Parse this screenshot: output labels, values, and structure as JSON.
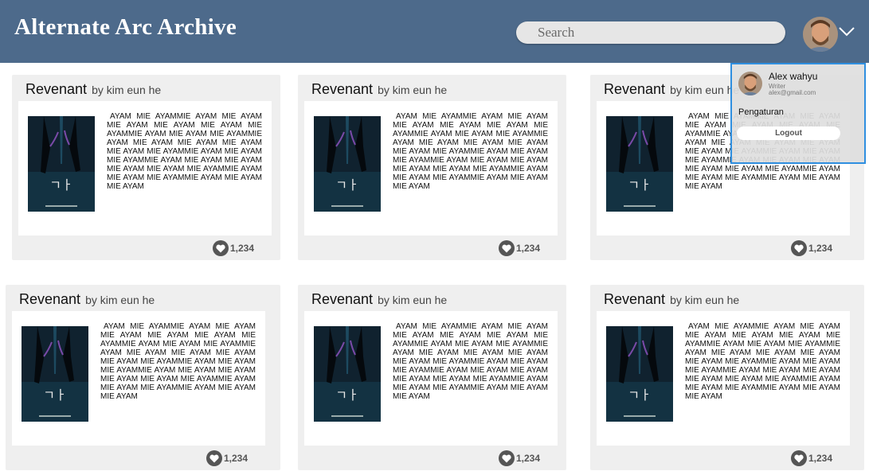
{
  "header": {
    "title": "Alternate Arc Archive",
    "search_placeholder": "Search"
  },
  "user_menu": {
    "name": "Alex wahyu",
    "role": "Writer",
    "email": "alex@gmail.com",
    "settings_label": "Pengaturan",
    "logout_label": "Logout"
  },
  "cards": [
    {
      "title": "Revenant",
      "author": "by kim eun he",
      "description": "AYAM MIE AYAMMIE AYAM MIE AYAM MIE AYAM MIE AYAM MIE AYAM MIE AYAMMIE AYAM MIE AYAM MIE AYAMMIE AYAM MIE AYAM MIE AYAM MIE AYAM MIE AYAM MIE AYAMMIE AYAM MIE AYAM MIE AYAMMIE AYAM MIE AYAM MIE AYAM MIE AYAM MIE AYAM MIE AYAMMIE AYAM MIE AYAM MIE AYAMMIE AYAM MIE AYAM MIE AYAM",
      "likes": "1,234"
    },
    {
      "title": "Revenant",
      "author": "by kim eun he",
      "description": "AYAM MIE AYAMMIE AYAM MIE AYAM MIE AYAM MIE AYAM MIE AYAM MIE AYAMMIE AYAM MIE AYAM MIE AYAMMIE AYAM MIE AYAM MIE AYAM MIE AYAM MIE AYAM MIE AYAMMIE AYAM MIE AYAM MIE AYAMMIE AYAM MIE AYAM MIE AYAM MIE AYAM MIE AYAM MIE AYAMMIE AYAM MIE AYAM MIE AYAMMIE AYAM MIE AYAM MIE AYAM",
      "likes": "1,234"
    },
    {
      "title": "Revenant",
      "author": "by kim eun he",
      "description": "AYAM MIE AYAMMIE AYAM MIE AYAM MIE AYAM MIE AYAM MIE AYAM MIE AYAMMIE AYAM MIE AYAM MIE AYAMMIE AYAM MIE AYAM MIE AYAM MIE AYAM MIE AYAM MIE AYAMMIE AYAM MIE AYAM MIE AYAMMIE AYAM MIE AYAM MIE AYAM MIE AYAM MIE AYAM MIE AYAMMIE AYAM MIE AYAM MIE AYAMMIE AYAM MIE AYAM MIE AYAM",
      "likes": "1,234"
    },
    {
      "title": "Revenant",
      "author": "by kim eun he",
      "description": "AYAM MIE AYAMMIE AYAM MIE AYAM MIE AYAM MIE AYAM MIE AYAM MIE AYAMMIE AYAM MIE AYAM MIE AYAMMIE AYAM MIE AYAM MIE AYAM MIE AYAM MIE AYAM MIE AYAMMIE AYAM MIE AYAM MIE AYAMMIE AYAM MIE AYAM MIE AYAM MIE AYAM MIE AYAM MIE AYAMMIE AYAM MIE AYAM MIE AYAMMIE AYAM MIE AYAM MIE AYAM",
      "likes": "1,234"
    },
    {
      "title": "Revenant",
      "author": "by kim eun he",
      "description": "AYAM MIE AYAMMIE AYAM MIE AYAM MIE AYAM MIE AYAM MIE AYAM MIE AYAMMIE AYAM MIE AYAM MIE AYAMMIE AYAM MIE AYAM MIE AYAM MIE AYAM MIE AYAM MIE AYAMMIE AYAM MIE AYAM MIE AYAMMIE AYAM MIE AYAM MIE AYAM MIE AYAM MIE AYAM MIE AYAMMIE AYAM MIE AYAM MIE AYAMMIE AYAM MIE AYAM MIE AYAM",
      "likes": "1,234"
    },
    {
      "title": "Revenant",
      "author": "by kim eun he",
      "description": "AYAM MIE AYAMMIE AYAM MIE AYAM MIE AYAM MIE AYAM MIE AYAM MIE AYAMMIE AYAM MIE AYAM MIE AYAMMIE AYAM MIE AYAM MIE AYAM MIE AYAM MIE AYAM MIE AYAMMIE AYAM MIE AYAM MIE AYAMMIE AYAM MIE AYAM MIE AYAM MIE AYAM MIE AYAM MIE AYAMMIE AYAM MIE AYAM MIE AYAMMIE AYAM MIE AYAM MIE AYAM",
      "likes": "1,234"
    }
  ],
  "icons": {
    "avatar": "avatar-photo",
    "dropdown": "chevron-down-icon",
    "like": "heart-icon",
    "cover": "book-cover-image"
  },
  "colors": {
    "header": "#4d6a8b",
    "card": "#efefef",
    "dropdown_border": "#2f8fe0"
  }
}
